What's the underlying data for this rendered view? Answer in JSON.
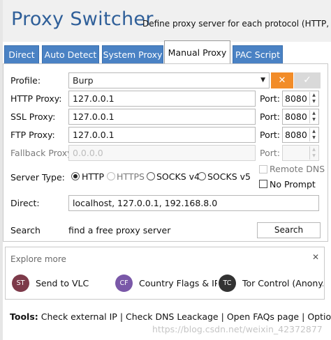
{
  "header": {
    "title": "Proxy Switcher",
    "subtitle": "Define proxy server for each protocol (HTTP, H"
  },
  "tabs": [
    {
      "label": "Direct",
      "active": false
    },
    {
      "label": "Auto Detect",
      "active": false
    },
    {
      "label": "System Proxy",
      "active": false
    },
    {
      "label": "Manual Proxy",
      "active": true
    },
    {
      "label": "PAC Script",
      "active": false
    }
  ],
  "form": {
    "profile_label": "Profile:",
    "profile_value": "Burp",
    "profile_delete_glyph": "✕",
    "profile_save_glyph": "✓",
    "http_label": "HTTP Proxy:",
    "http_value": "127.0.0.1",
    "ssl_label": "SSL Proxy:",
    "ssl_value": "127.0.0.1",
    "ftp_label": "FTP Proxy:",
    "ftp_value": "127.0.0.1",
    "fallback_label": "Fallback Proxy:",
    "fallback_placeholder": "0.0.0.0",
    "port_label": "Port:",
    "http_port": "8080",
    "ssl_port": "8080",
    "ftp_port": "8080",
    "fallback_port": "",
    "remote_dns_label": "Remote DNS",
    "no_prompt_label": "No Prompt",
    "server_type_label": "Server Type:",
    "server_types": [
      "HTTP",
      "HTTPS",
      "SOCKS v4",
      "SOCKS v5"
    ],
    "server_type_selected": "HTTP",
    "direct_label": "Direct:",
    "direct_value": "localhost, 127.0.0.1, 192.168.8.0",
    "search_label": "Search",
    "search_hint": "find a free proxy server",
    "search_button": "Search"
  },
  "explore": {
    "title": "Explore more",
    "close_glyph": "✕",
    "items": [
      {
        "initials": "ST",
        "label": "Send to VLC",
        "color": "#7d3a4a"
      },
      {
        "initials": "CF",
        "label": "Country Flags & IP ...",
        "color": "#7a58a8"
      },
      {
        "initials": "TC",
        "label": "Tor Control (Anony...",
        "color": "#333333"
      }
    ]
  },
  "tools": {
    "prefix": "Tools:",
    "links": [
      "Check external IP",
      "Check DNS Leackage",
      "Open FAQs page",
      "Options"
    ],
    "separator": "|"
  },
  "watermark": "https://blog.csdn.net/weixin_42372877",
  "colors": {
    "title_blue": "#2f5f99",
    "tab_blue": "#4a82c4",
    "delete_orange": "#f28c28"
  }
}
